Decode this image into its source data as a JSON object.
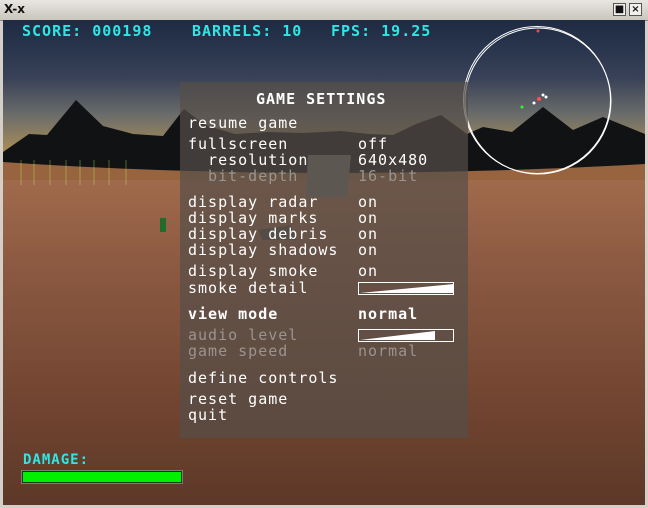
{
  "window": {
    "app_icon": "X-x",
    "buttons": [
      "■",
      "×"
    ]
  },
  "hud": {
    "score": "SCORE: 000198",
    "barrels": "BARRELS: 10",
    "fps": "FPS: 19.25",
    "damage_label": "DAMAGE:",
    "damage_level": 0.99
  },
  "menu": {
    "title": "GAME SETTINGS",
    "items": [
      {
        "label": "resume game",
        "value": ""
      },
      {
        "label": "fullscreen",
        "value": "off"
      },
      {
        "label": "  resolution",
        "value": "640x480"
      },
      {
        "label": "  bit-depth",
        "value": "16-bit"
      },
      {
        "label": "display radar",
        "value": "on"
      },
      {
        "label": "display marks",
        "value": "on"
      },
      {
        "label": "display debris",
        "value": "on"
      },
      {
        "label": "display shadows",
        "value": "on"
      },
      {
        "label": "display smoke",
        "value": "on"
      },
      {
        "label": "smoke detail",
        "value": "",
        "slider_level": 1.0
      },
      {
        "label": "view mode",
        "value": "normal"
      },
      {
        "label": "audio level",
        "value": "",
        "slider_level": 0.8
      },
      {
        "label": "game speed",
        "value": "normal"
      },
      {
        "label": "define controls",
        "value": ""
      },
      {
        "label": "reset game",
        "value": ""
      },
      {
        "label": "quit",
        "value": ""
      }
    ]
  },
  "colors": {
    "hud_text": "#2ee6e6",
    "menu_text": "#ffffff",
    "dim_text": "#9a948f",
    "damage_fill": "#00f000",
    "radar_outline": "#ffffff"
  }
}
